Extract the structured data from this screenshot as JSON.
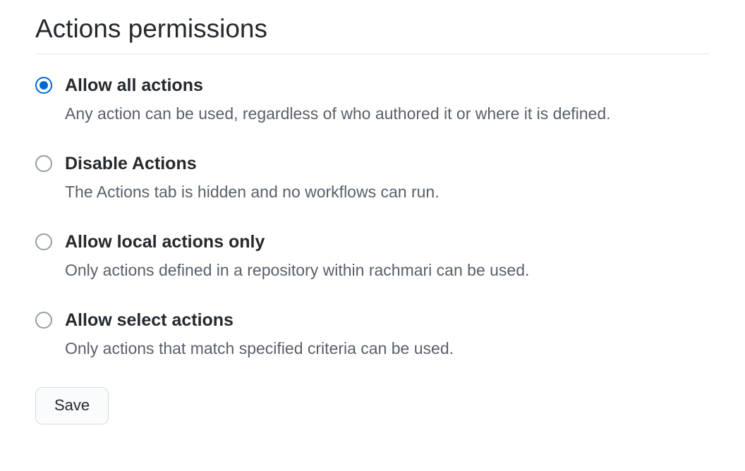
{
  "section": {
    "title": "Actions permissions"
  },
  "options": [
    {
      "id": "allow-all",
      "title": "Allow all actions",
      "description": "Any action can be used, regardless of who authored it or where it is defined.",
      "selected": true
    },
    {
      "id": "disable",
      "title": "Disable Actions",
      "description": "The Actions tab is hidden and no workflows can run.",
      "selected": false
    },
    {
      "id": "allow-local",
      "title": "Allow local actions only",
      "description": "Only actions defined in a repository within rachmari can be used.",
      "selected": false
    },
    {
      "id": "allow-select",
      "title": "Allow select actions",
      "description": "Only actions that match specified criteria can be used.",
      "selected": false
    }
  ],
  "buttons": {
    "save": "Save"
  }
}
